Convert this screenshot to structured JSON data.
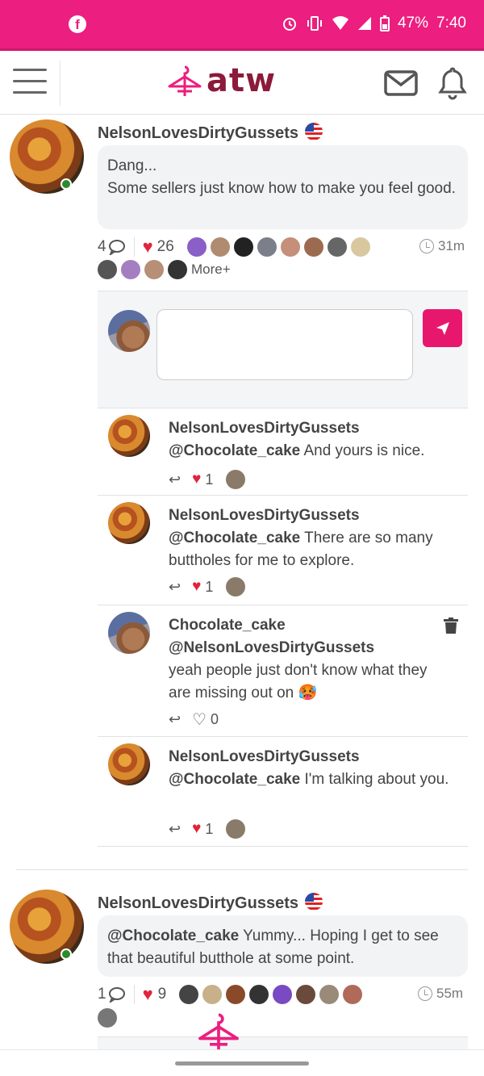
{
  "status_bar": {
    "battery": "47%",
    "time": "7:40"
  },
  "header": {
    "logo_text": "atw"
  },
  "posts": [
    {
      "author": "NelsonLovesDirtyGussets",
      "text": "Dang...\nSome sellers just know how to make you feel good.",
      "comments": "4",
      "likes": "26",
      "time": "31m",
      "more": "More+"
    },
    {
      "author": "NelsonLovesDirtyGussets",
      "mention": "@Chocolate_cake",
      "text": "Yummy... Hoping I get to see that beautiful butthole at some point.",
      "comments": "1",
      "likes": "9",
      "time": "55m"
    }
  ],
  "replies": [
    {
      "author": "NelsonLovesDirtyGussets",
      "mention": "@Chocolate_cake",
      "text": "And yours is nice.",
      "likes": "1"
    },
    {
      "author": "NelsonLovesDirtyGussets",
      "mention": "@Chocolate_cake",
      "text": "There are so many buttholes for me to explore.",
      "likes": "1"
    },
    {
      "author": "Chocolate_cake",
      "mention": "@NelsonLovesDirtyGussets",
      "text": "yeah people just don't know what they are missing out on 🥵",
      "likes": "0"
    },
    {
      "author": "NelsonLovesDirtyGussets",
      "mention": "@Chocolate_cake",
      "text": "I'm talking about you.",
      "likes": "1"
    }
  ],
  "colors": {
    "brand": "#ec1e7f",
    "logo": "#8b1a3b",
    "heart": "#e0243e"
  }
}
